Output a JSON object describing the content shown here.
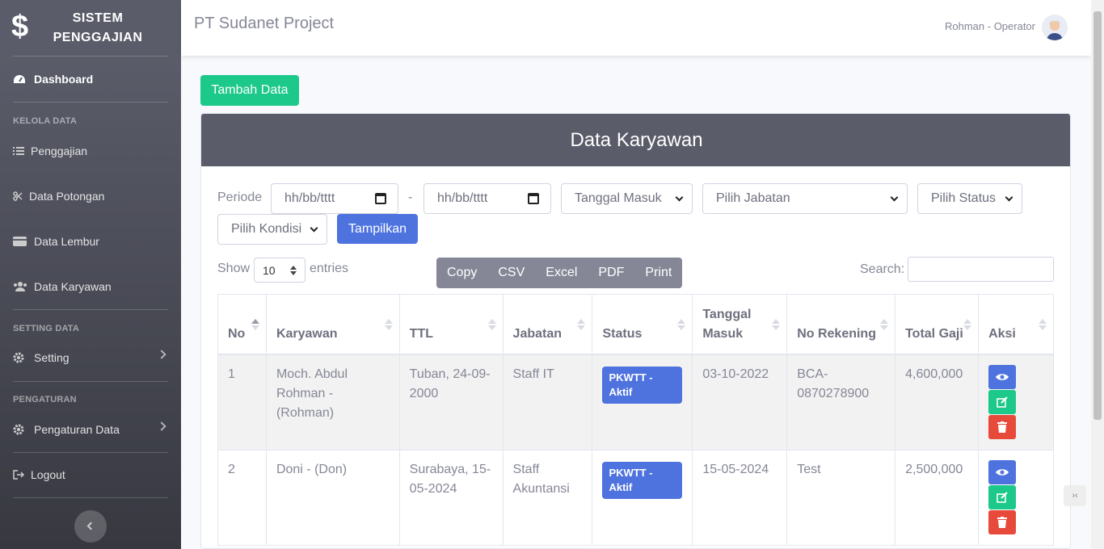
{
  "brand": {
    "line1": "SISTEM",
    "line2": "PENGGAJIAN",
    "icon": "dollar-icon"
  },
  "sidebar": {
    "dashboard": "Dashboard",
    "kelola_heading": "KELOLA DATA",
    "penggajian": "Penggajian",
    "potongan": "Data Potongan",
    "lembur": "Data Lembur",
    "karyawan": "Data Karyawan",
    "setting_heading": "SETTING DATA",
    "setting": "Setting",
    "pengaturan_heading": "PENGATURAN",
    "pengaturan": "Pengaturan Data",
    "logout": "Logout"
  },
  "topbar": {
    "title": "PT Sudanet Project",
    "user": "Rohman - Operator"
  },
  "main": {
    "add_button": "Tambah Data",
    "card_title": "Data Karyawan",
    "filter": {
      "periode_label": "Periode",
      "date_from": "hh/bb/tttt",
      "separator": "-",
      "date_to": "hh/bb/tttt",
      "tanggal_select": "Tanggal Masuk",
      "jabatan_select": "Pilih Jabatan",
      "status_select": "Pilih Status",
      "kondisi_select": "Pilih Kondisi",
      "show_button": "Tampilkan"
    },
    "length": {
      "show": "Show",
      "value": "10",
      "entries": "entries"
    },
    "export": [
      "Copy",
      "CSV",
      "Excel",
      "PDF",
      "Print"
    ],
    "search_label": "Search:",
    "columns": [
      "No",
      "Karyawan",
      "TTL",
      "Jabatan",
      "Status",
      "Tanggal Masuk",
      "No Rekening",
      "Total Gaji",
      "Aksi"
    ],
    "rows": [
      {
        "no": "1",
        "karyawan": "Moch. Abdul Rohman - (Rohman)",
        "ttl": "Tuban, 24-09-2000",
        "jabatan": "Staff IT",
        "status": "PKWTT - Aktif",
        "masuk": "03-10-2022",
        "rekening": "BCA-0870278900",
        "gaji": "4,600,000"
      },
      {
        "no": "2",
        "karyawan": "Doni - (Don)",
        "ttl": "Surabaya, 15-05-2024",
        "jabatan": "Staff Akuntansi",
        "status": "PKWTT - Aktif",
        "masuk": "15-05-2024",
        "rekening": "Test",
        "gaji": "2,500,000"
      }
    ]
  },
  "colors": {
    "sidebar": "#5a5c69",
    "success": "#1cc88a",
    "primary": "#4e73df",
    "danger": "#e74a3b"
  }
}
